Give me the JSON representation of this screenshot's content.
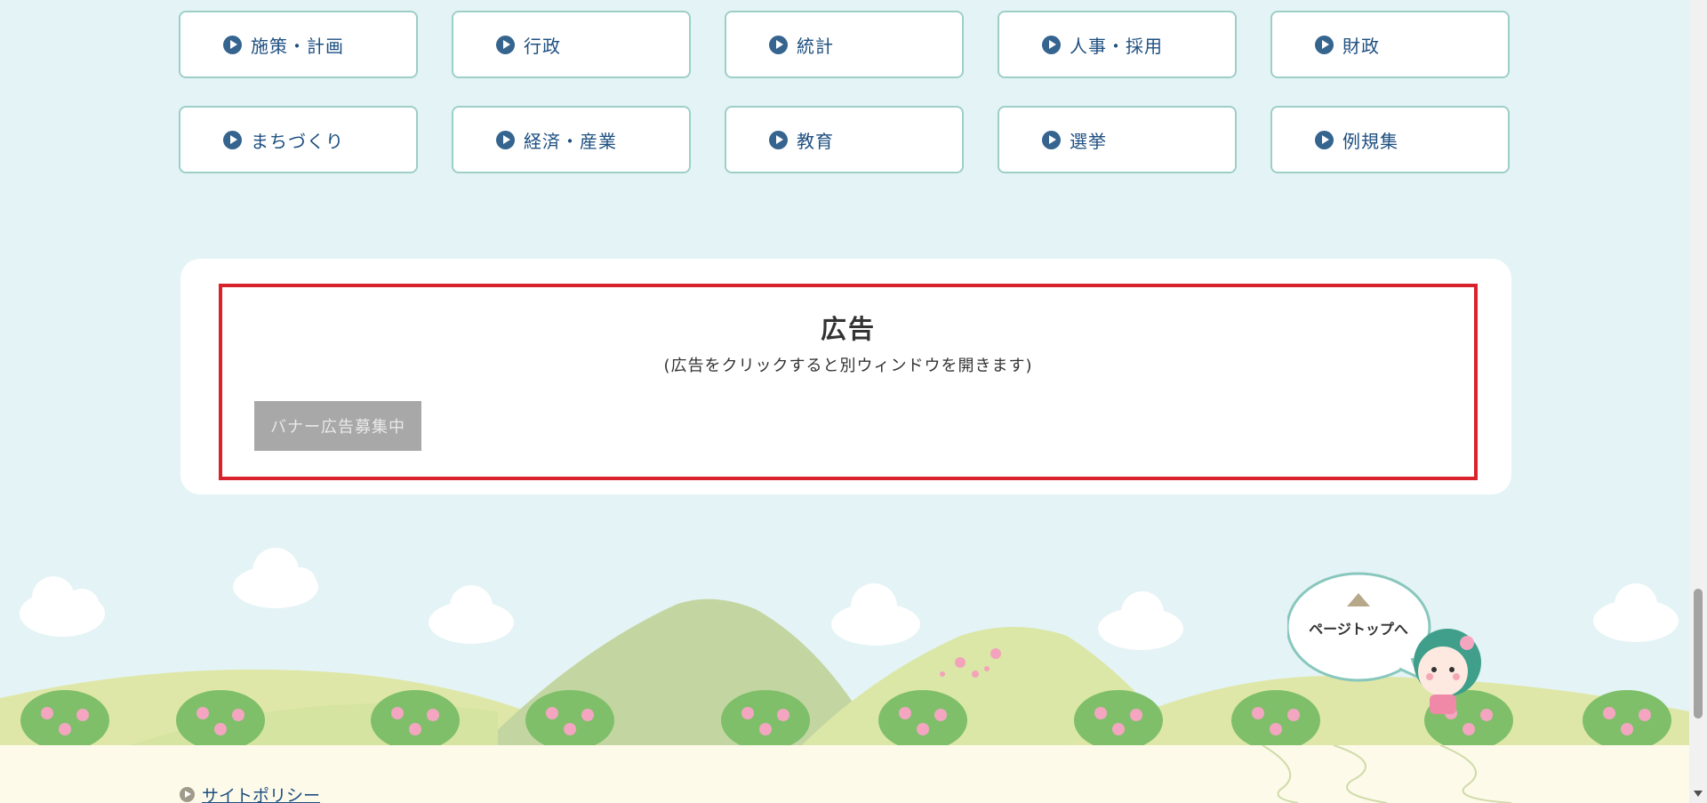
{
  "categories": [
    {
      "label": "施策・計画"
    },
    {
      "label": "行政"
    },
    {
      "label": "統計"
    },
    {
      "label": "人事・採用"
    },
    {
      "label": "財政"
    },
    {
      "label": "まちづくり"
    },
    {
      "label": "経済・産業"
    },
    {
      "label": "教育"
    },
    {
      "label": "選挙"
    },
    {
      "label": "例規集"
    }
  ],
  "ad": {
    "title": "広告",
    "note": "(広告をクリックすると別ウィンドウを開きます)",
    "banner_label": "バナー広告募集中"
  },
  "page_top": {
    "label": "ページトップへ"
  },
  "footer": {
    "site_policy_label": "サイトポリシー"
  },
  "colors": {
    "background": "#e4f3f5",
    "button_border": "#9dcfc8",
    "arrow_icon": "#35648f",
    "link_text": "#1d4f80",
    "ad_border": "#d9232c",
    "banner_bg": "#a8a8a8"
  }
}
